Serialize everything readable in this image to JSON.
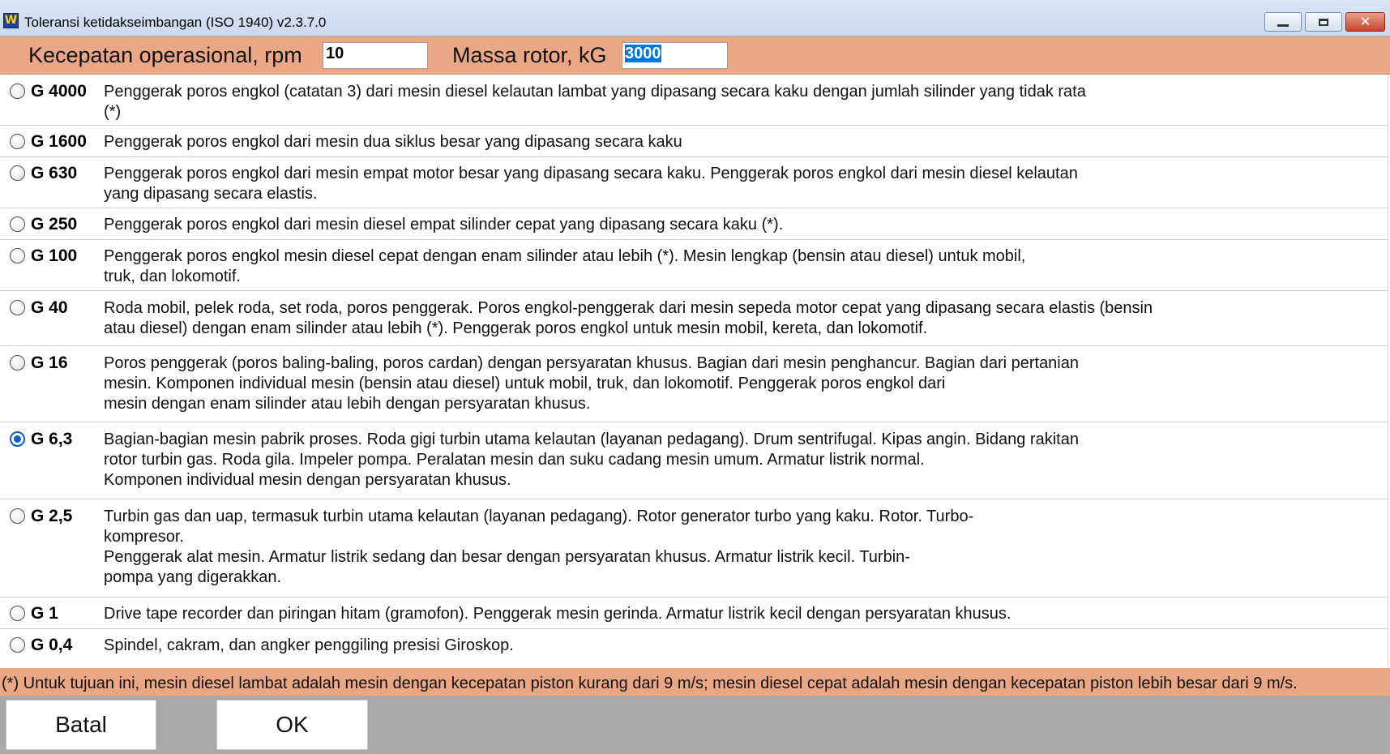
{
  "window": {
    "title": "Toleransi ketidakseimbangan (ISO 1940) v2.3.7.0",
    "icon_text": "W",
    "controls": [
      "minimize-icon",
      "maximize-icon",
      "close-icon"
    ]
  },
  "params": {
    "speed_label": "Kecepatan operasional, rpm",
    "speed_value": "10",
    "mass_label": "Massa rotor, kG",
    "mass_value": "3000"
  },
  "grades": [
    {
      "grade": "G 4000",
      "checked": false,
      "description": "Penggerak poros engkol (catatan 3) dari mesin diesel kelautan lambat yang dipasang secara kaku dengan jumlah silinder yang tidak rata\n(*)"
    },
    {
      "grade": "G 1600",
      "checked": false,
      "description": "Penggerak poros engkol dari mesin dua siklus besar yang dipasang secara kaku"
    },
    {
      "grade": "G 630",
      "checked": false,
      "description": "Penggerak poros engkol dari mesin empat motor besar yang dipasang secara kaku. Penggerak poros engkol dari mesin diesel kelautan\nyang dipasang secara elastis."
    },
    {
      "grade": "G 250",
      "checked": false,
      "description": "Penggerak poros engkol dari mesin diesel empat silinder cepat yang dipasang secara kaku (*)."
    },
    {
      "grade": "G 100",
      "checked": false,
      "description": "Penggerak poros engkol mesin diesel cepat dengan enam silinder atau lebih (*). Mesin lengkap (bensin atau diesel) untuk mobil,\ntruk, dan lokomotif."
    },
    {
      "grade": "G 40",
      "checked": false,
      "description": "Roda mobil, pelek roda, set roda, poros penggerak. Poros engkol-penggerak dari mesin sepeda motor cepat yang dipasang secara elastis (bensin\natau diesel) dengan enam silinder atau lebih (*). Penggerak poros engkol untuk mesin mobil, kereta, dan lokomotif."
    },
    {
      "grade": "G 16",
      "checked": false,
      "description": "Poros penggerak (poros baling-baling, poros cardan) dengan persyaratan khusus. Bagian dari mesin penghancur. Bagian dari pertanian\nmesin. Komponen individual mesin (bensin atau diesel) untuk mobil, truk, dan lokomotif. Penggerak poros engkol dari\nmesin dengan enam silinder atau lebih dengan persyaratan khusus."
    },
    {
      "grade": "G 6,3",
      "checked": true,
      "description": " Bagian-bagian mesin pabrik proses. Roda gigi turbin utama kelautan (layanan pedagang). Drum sentrifugal. Kipas angin. Bidang rakitan\nrotor turbin gas. Roda gila. Impeler pompa. Peralatan mesin dan suku cadang mesin umum. Armatur listrik normal.\nKomponen individual mesin dengan persyaratan khusus."
    },
    {
      "grade": "G 2,5",
      "checked": false,
      "description": "Turbin gas dan uap, termasuk turbin utama kelautan (layanan pedagang). Rotor generator turbo yang kaku. Rotor. Turbo-\nkompresor.\nPenggerak alat mesin. Armatur listrik sedang dan besar dengan persyaratan khusus. Armatur listrik kecil. Turbin-\npompa yang digerakkan."
    },
    {
      "grade": "G 1",
      "checked": false,
      "description": "Drive tape recorder dan piringan hitam (gramofon). Penggerak mesin gerinda. Armatur listrik kecil dengan persyaratan khusus."
    },
    {
      "grade": "G 0,4",
      "checked": false,
      "description": "Spindel, cakram, dan angker penggiling presisi Giroskop."
    }
  ],
  "footnote": "(*) Untuk tujuan ini, mesin diesel lambat adalah mesin dengan kecepatan piston kurang dari 9 m/s; mesin diesel cepat adalah mesin dengan kecepatan piston lebih besar dari 9 m/s.",
  "buttons": {
    "cancel": "Batal",
    "ok": "OK"
  },
  "colors": {
    "accent_band": "#eba686",
    "radio_checked": "#0a5fc4",
    "bottom_area": "#a9a9a9"
  }
}
